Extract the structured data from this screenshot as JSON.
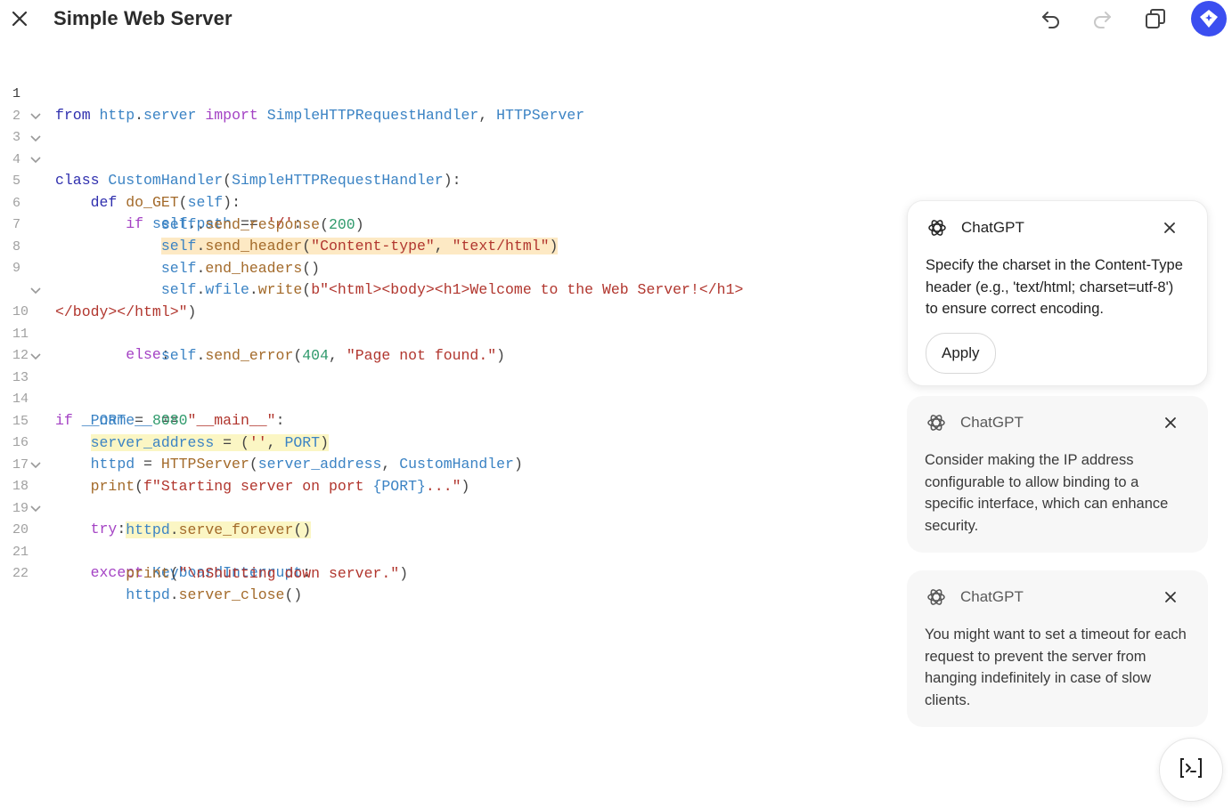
{
  "header": {
    "title": "Simple Web Server"
  },
  "editor": {
    "lines": [
      {
        "n": "1"
      },
      {
        "n": "2"
      },
      {
        "n": "3"
      },
      {
        "n": "4"
      },
      {
        "n": "5"
      },
      {
        "n": "6"
      },
      {
        "n": "7"
      },
      {
        "n": "8"
      },
      {
        "n": "9"
      },
      {
        "n": ""
      },
      {
        "n": "10"
      },
      {
        "n": "11"
      },
      {
        "n": "12"
      },
      {
        "n": "13"
      },
      {
        "n": "14"
      },
      {
        "n": "15"
      },
      {
        "n": "16"
      },
      {
        "n": "17"
      },
      {
        "n": "18"
      },
      {
        "n": "19"
      },
      {
        "n": "20"
      },
      {
        "n": "21"
      },
      {
        "n": "22"
      }
    ]
  },
  "suggestions": [
    {
      "author": "ChatGPT",
      "text": "Specify the charset in the Content-Type header (e.g., 'text/html; charset=utf-8') to ensure correct encoding.",
      "action": "Apply"
    },
    {
      "author": "ChatGPT",
      "text": "Consider making the IP address configurable to allow binding to a specific interface, which can enhance security."
    },
    {
      "author": "ChatGPT",
      "text": "You might want to set a timeout for each request to prevent the server from hanging indefinitely in case of slow clients."
    }
  ],
  "colors": {
    "accent": "#3b4ef0",
    "highlight_orange": "#fde9c4",
    "highlight_yellow": "#fbf6c4"
  }
}
